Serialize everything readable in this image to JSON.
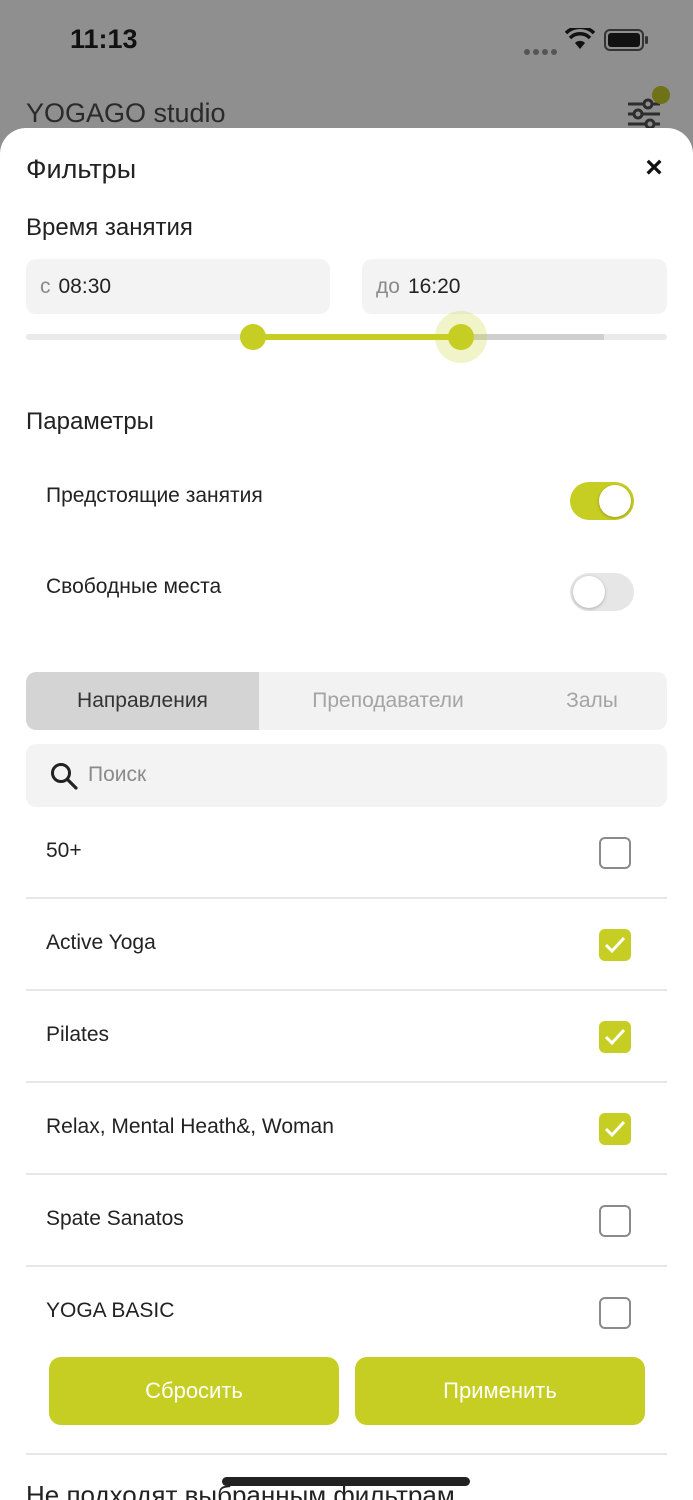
{
  "status_bar": {
    "time": "11:13"
  },
  "app": {
    "title": "YOGAGO studio"
  },
  "sheet": {
    "title": "Фильтры",
    "close_glyph": "×"
  },
  "time_section": {
    "label": "Время занятия",
    "from_prefix": "с",
    "from_value": "08:30",
    "to_prefix": "до",
    "to_value": "16:20"
  },
  "params": {
    "label": "Параметры",
    "items": [
      {
        "label": "Предстоящие занятия",
        "on": true
      },
      {
        "label": "Свободные места",
        "on": false
      }
    ]
  },
  "tabs": [
    {
      "label": "Направления",
      "active": true
    },
    {
      "label": "Преподаватели",
      "active": false
    },
    {
      "label": "Залы",
      "active": false
    }
  ],
  "search": {
    "placeholder": "Поиск"
  },
  "list": [
    {
      "label": "50+",
      "checked": false
    },
    {
      "label": "Active Yoga",
      "checked": true
    },
    {
      "label": "Pilates",
      "checked": true
    },
    {
      "label": "Relax, Mental Heath&, Woman",
      "checked": true
    },
    {
      "label": "Spate Sanatos",
      "checked": false
    },
    {
      "label": "YOGA BASIC",
      "checked": false
    }
  ],
  "actions": {
    "reset": "Сбросить",
    "apply": "Применить"
  },
  "footer_text": "Не подходят выбранным фильтрам",
  "colors": {
    "accent": "#c7ce23"
  }
}
